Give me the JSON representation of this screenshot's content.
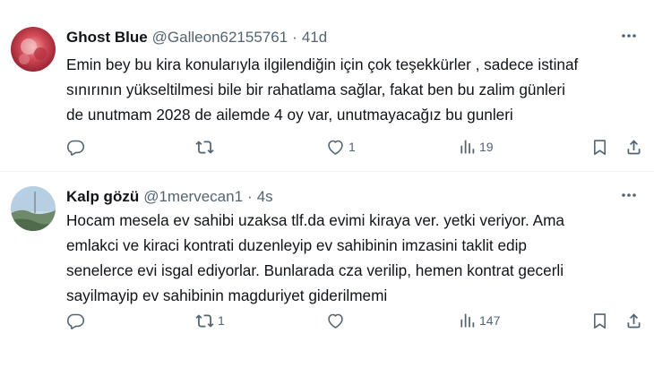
{
  "tweets": [
    {
      "name": "Ghost Blue",
      "handle": "@Galleon62155761",
      "separator": "·",
      "time": "41d",
      "text": "Emin bey bu kira konularıyla ilgilendiğin için çok teşekkürler , sadece istinaf\nsınırının yükseltilmesi bile bir rahatlama sağlar, fakat ben bu zalim günleri\nde unutmam 2028 de ailemde 4 oy var, unutmayacağız bu gunleri",
      "replies": "",
      "retweets": "",
      "likes": "1",
      "views": "19"
    },
    {
      "name": "Kalp gözü",
      "handle": "@1mervecan1",
      "separator": "·",
      "time": "4s",
      "text": "Hocam mesela  ev sahibi uzaksa  tlf.da  evimi kiraya ver. yetki veriyor. Ama\nemlakci ve kiraci kontrati duzenleyip ev sahibinin imzasini taklit edip\nsenelerce evi isgal ediyorlar.  Bunlarada cza verilip, hemen kontrat gecerli\nsayilmayip ev sahibinin  magduriyet giderilmemi",
      "replies": "",
      "retweets": "1",
      "likes": "",
      "views": "147"
    }
  ],
  "icons": [
    "more-icon",
    "reply-icon",
    "retweet-icon",
    "like-icon",
    "views-icon",
    "bookmark-icon",
    "share-icon"
  ],
  "colors": {
    "text": "#0f1419",
    "secondary": "#536471",
    "divider": "#eff3f4"
  }
}
